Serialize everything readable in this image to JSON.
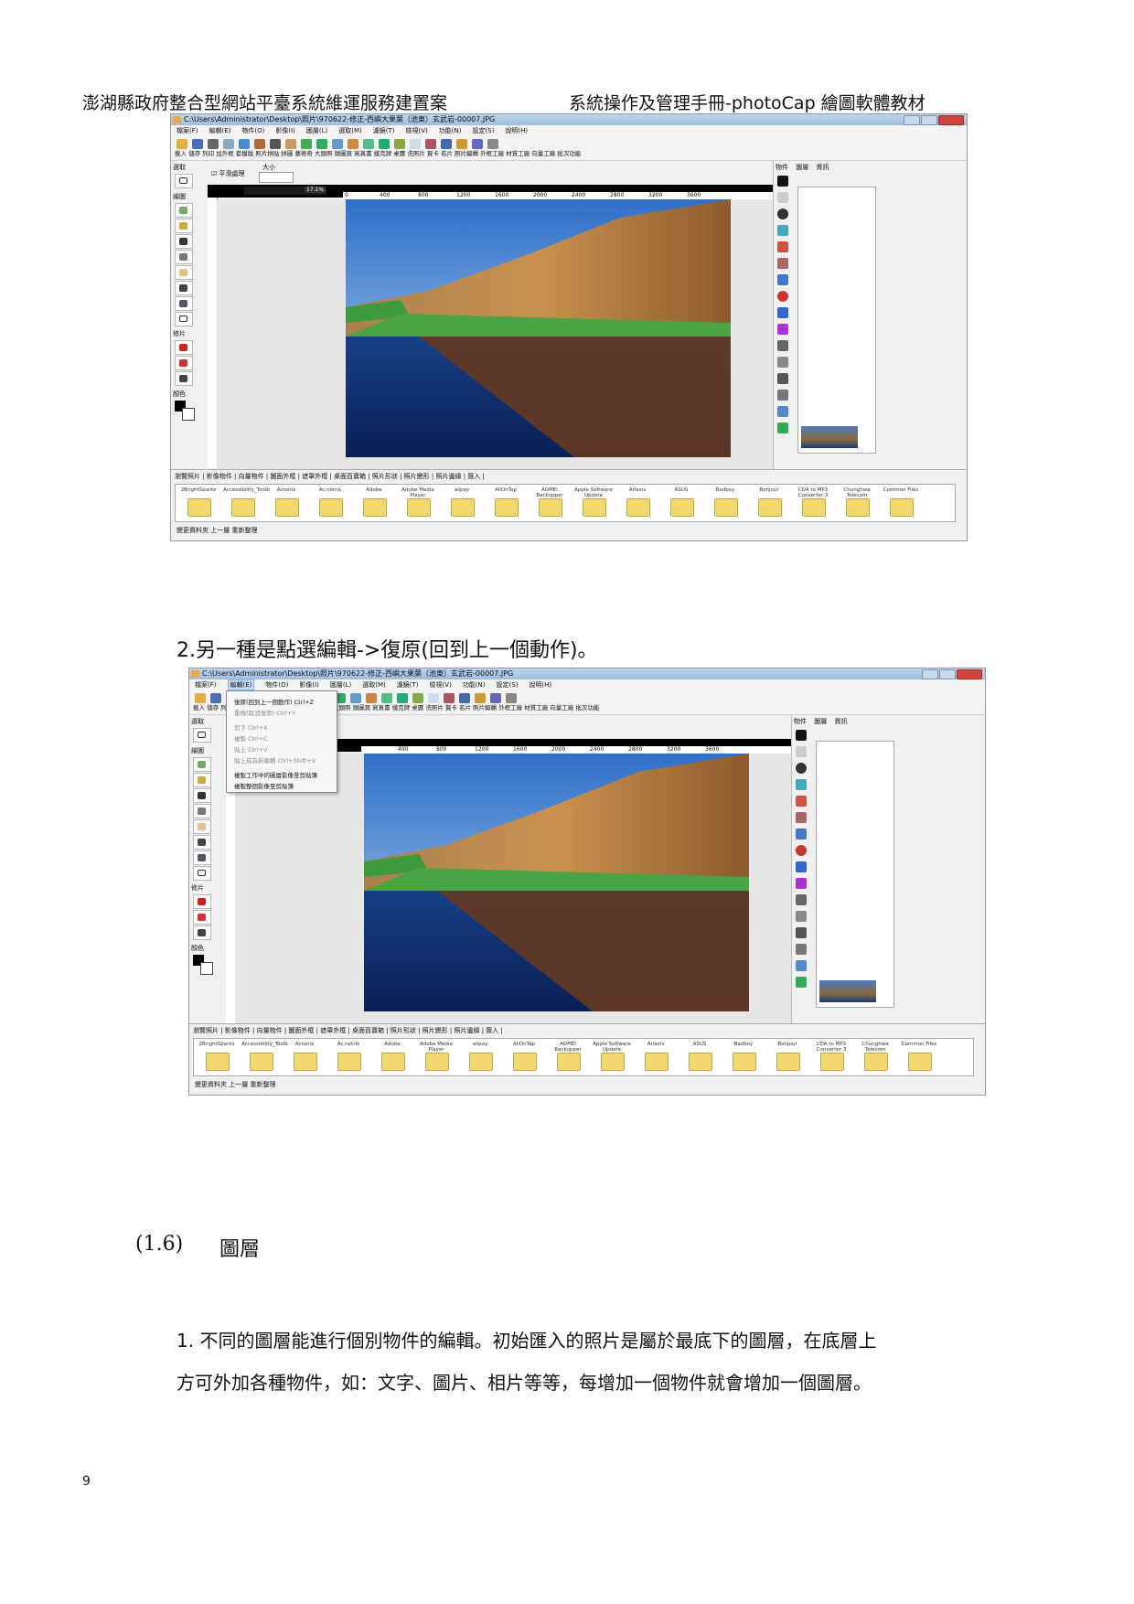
{
  "header": {
    "left": "澎湖縣政府整合型網站平臺系統維運服務建置案",
    "right": "系統操作及管理手冊-photoCap 繪圖軟體教材"
  },
  "app": {
    "window_title": "C:\\Users\\Administrator\\Desktop\\照片\\970622-修正-西嶼大果葉（池東）玄武岩-00007.JPG",
    "menu": [
      "檔案(F)",
      "編輯(E)",
      "物件(O)",
      "影像(I)",
      "圖層(L)",
      "選取(M)",
      "濾鏡(T)",
      "檢視(V)",
      "功能(N)",
      "設定(S)",
      "說明(H)"
    ],
    "toolbar_labels": "載入 儲存 列印  加外框 套模版 照片拼貼 拼圖 藝術奇 大頭照 頭圖頁 寫真書 撲克牌 桌曆 洗照片 賀卡  名片 照片編輯 外框工廠 材質工廠 向量工廠 批次功能",
    "panel_labels": {
      "select": "選取",
      "draw": "繪圖",
      "retouch": "修片",
      "color": "顏色"
    },
    "option_bar": {
      "smooth": "平滑處理",
      "size_label": "大小"
    },
    "zoom": "17.1%",
    "ruler_ticks": [
      "0",
      "400",
      "800",
      "1200",
      "1600",
      "2000",
      "2400",
      "2800",
      "3200",
      "3600"
    ],
    "right_panel_tabs": [
      "物件",
      "圖層",
      "資訊"
    ],
    "bottom_tabs": "瀏覽照片 | 影像物件 | 向量物件 | 圖面外框 | 遮罩外框 | 桌面百寶箱 | 照片形狀 | 照片變形 | 照片邊緣 | 匯入 |",
    "folders": [
      "2BrightSparks",
      "Accessibility_Toolb",
      "Actonix",
      "Ac.netrix",
      "Adobe",
      "Adobe Media Player",
      "alipay",
      "AllOnTap",
      "AOMEI Backupper",
      "Apple Software Update",
      "Arlaxis",
      "ASUS",
      "Badboy",
      "Bonjour",
      "CDA to MP3 Converter 3",
      "Chunghwa Telecom",
      "Common Files"
    ],
    "status": "變更資料夾    上一層    重新整理"
  },
  "edit_menu": {
    "items": [
      {
        "label": "復原(回到上一個動作)  Ctrl+Z",
        "enabled": true
      },
      {
        "label": "重做(取消復原)  Ctrl+Y",
        "enabled": false
      },
      {
        "label": "剪下  Ctrl+X",
        "enabled": false
      },
      {
        "label": "複製  Ctrl+C",
        "enabled": false
      },
      {
        "label": "貼上  Ctrl+V",
        "enabled": false
      },
      {
        "label": "貼上成為新編輯  Ctrl+Shift+V",
        "enabled": false
      },
      {
        "label": "複製工作中的圖層影像至剪貼簿",
        "enabled": true
      },
      {
        "label": "複製整個影像至剪貼簿",
        "enabled": true
      }
    ]
  },
  "step2_text": "2.另一種是點選編輯->復原(回到上一個動作)。",
  "section": {
    "number": "(1.6)",
    "title": "圖層"
  },
  "paragraph": {
    "line1": "1. 不同的圖層能進行個別物件的編輯。初始匯入的照片是屬於最底下的圖層，在底層上",
    "line2": "方可外加各種物件，如：文字、圖片、相片等等，每增加一個物件就會增加一個圖層。"
  },
  "page_number": "9",
  "colors": {
    "folder": "#f4d671",
    "titlebar": "#a9c6e6",
    "menu_highlight": "#c6dcf3"
  }
}
